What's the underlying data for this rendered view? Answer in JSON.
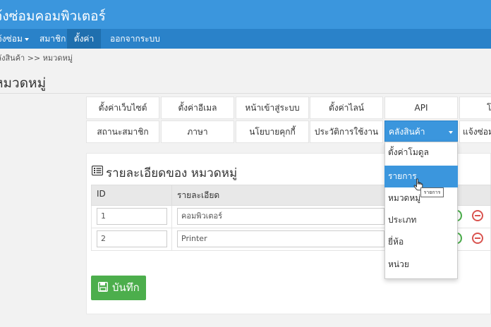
{
  "app": {
    "title": "แจ้งซ่อมคอมพิวเตอร์"
  },
  "navbar": {
    "items": [
      {
        "label": "แจ้งซ่อม",
        "dropdown": true
      },
      {
        "label": "สมาชิก"
      },
      {
        "label": "ตั้งค่า",
        "active": true
      },
      {
        "label": "ออกจากระบบ"
      }
    ]
  },
  "breadcrumb": "คลังสินค้า >> หมวดหมู่",
  "page": {
    "title": "หมวดหมู่"
  },
  "settings_tiles": {
    "row1": [
      "ตั้งค่าเว็บไซต์",
      "ตั้งค่าอีเมล",
      "หน้าเข้าสู่ระบบ",
      "ตั้งค่าไลน์",
      "API",
      "โม"
    ],
    "row2": [
      "สถานะสมาชิก",
      "ภาษา",
      "นโยบายคุกกี้",
      "ประวัติการใช้งาน",
      "คลังสินค้า",
      "แจ้งซ่อม"
    ]
  },
  "panel": {
    "heading": "รายละเอียดของ หมวดหมู่",
    "columns": [
      "ID",
      "รายละเอียด"
    ],
    "rows": [
      {
        "id": "1",
        "detail": "คอมพิวเตอร์"
      },
      {
        "id": "2",
        "detail": "Printer"
      }
    ],
    "save_label": "บันทึก"
  },
  "dropdown": {
    "items": [
      "ตั้งค่าโมดูล",
      "รายการ",
      "หมวดหมู่",
      "ประเภท",
      "ยี่ห้อ",
      "หน่วย"
    ],
    "hovered_index": 1,
    "tooltip": "รายการ"
  },
  "colors": {
    "primary": "#3b96dd",
    "navbar": "#2a82c9",
    "success": "#4cae4c",
    "danger": "#d9534f"
  }
}
